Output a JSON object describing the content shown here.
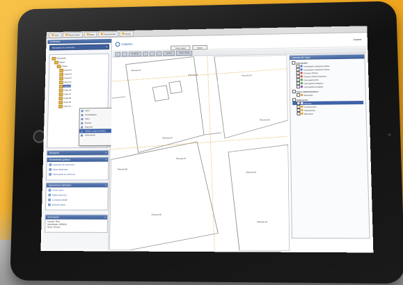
{
  "top_tabs": [
    {
      "label": "Inicio"
    },
    {
      "label": "Buscar datos"
    },
    {
      "label": "Mapa"
    },
    {
      "label": "Herramientas"
    },
    {
      "label": "Ayuda"
    }
  ],
  "left": {
    "header": "Contenidos",
    "combo_value": "Navegador de contenidos",
    "tree_items": [
      {
        "label": "Navegador"
      },
      {
        "label": "Mapas"
      },
      {
        "label": "Capas"
      },
      {
        "label": "Capa 01"
      },
      {
        "label": "Capa 02"
      },
      {
        "label": "Capa 03"
      },
      {
        "label": "Capa 04"
      },
      {
        "label": "Capa 05"
      },
      {
        "label": "Capa 06"
      },
      {
        "label": "Capa 07"
      },
      {
        "label": "Capa 08"
      },
      {
        "label": "Capa 09"
      },
      {
        "label": "Capa 10"
      }
    ],
    "context_menu": [
      {
        "label": "Abrir"
      },
      {
        "label": "Propiedades"
      },
      {
        "label": "Filtro"
      },
      {
        "label": "Buscar"
      },
      {
        "label": "Exportar"
      },
      {
        "label": "Añadir a capa temática",
        "selected": true
      },
      {
        "label": "Información"
      }
    ],
    "sections": [
      {
        "title": "Búsqueda",
        "links": []
      },
      {
        "title": "Herramientas gráficas",
        "links": [
          {
            "label": "Selección de elementos"
          },
          {
            "label": "Medir distancias"
          },
          {
            "label": "Información de elemento"
          }
        ]
      },
      {
        "title": "Operaciones habituales",
        "links": [
          {
            "label": "Crear nuevo"
          },
          {
            "label": "Editar elemento"
          },
          {
            "label": "Consultar detalle"
          },
          {
            "label": "Exportar datos"
          }
        ]
      },
      {
        "title": "Información",
        "links": []
      }
    ],
    "bottom_info": [
      "Usuario: Rico",
      "Identificado: 18/06/11",
      "Nivel: Técnico"
    ]
  },
  "map": {
    "logo": "Catastro",
    "user": "Usuario",
    "buttons": [
      {
        "label": "Vista mapa"
      },
      {
        "label": "Datos"
      }
    ],
    "toolbar": [
      {
        "icon": "zoom-in-icon",
        "label": "+"
      },
      {
        "icon": "zoom-out-icon",
        "label": "−"
      },
      {
        "icon": "pan-icon",
        "label": "Desplazar"
      },
      {
        "icon": "select-icon",
        "label": "↖"
      },
      {
        "icon": "measure-icon",
        "label": "↔"
      },
      {
        "icon": "info-icon",
        "label": "i"
      },
      {
        "icon": "print-icon",
        "label": "Imprimir"
      },
      {
        "icon": "layers-icon",
        "label": "Capas visibles"
      }
    ],
    "labels": [
      "Parcela 01",
      "Parcela 02",
      "Parcela 03",
      "Parcela 04",
      "Parcela 05",
      "Parcela 06",
      "Parcela 07",
      "Parcela 08",
      "Parcela 09",
      "Parcela 10"
    ]
  },
  "legend": {
    "header": "Leyenda del mapa",
    "groups": [
      {
        "title": "Cartografía",
        "items": [
          {
            "label": "Cartografía catastral urbana",
            "color": "#3c6fd0"
          },
          {
            "label": "Cartografía catastral rústica",
            "color": "#3c6fd0"
          },
          {
            "label": "Ortofoto PNOA",
            "color": "#d04a3c"
          },
          {
            "label": "Ortofoto PNOA histórica",
            "color": "#d04a3c"
          },
          {
            "label": "Cartografía IGN",
            "color": "#4aa04a"
          },
          {
            "label": "Cartografía Callejero",
            "color": "#4aa04a"
          },
          {
            "label": "Cartografía temática",
            "color": "#8a4ac8"
          }
        ]
      },
      {
        "title": "Datos administrativos",
        "items": [
          {
            "label": "Municipio",
            "color": "#e0a030"
          }
        ]
      },
      {
        "title": "Edificación",
        "items": [
          {
            "label": "Parcela",
            "color": "#3e62a8",
            "selected": true
          },
          {
            "label": "Construcción",
            "color": "#f0a020"
          },
          {
            "label": "Subparcela",
            "color": "#f0a020"
          },
          {
            "label": "Elemento",
            "color": "#f0a020"
          }
        ]
      }
    ]
  }
}
